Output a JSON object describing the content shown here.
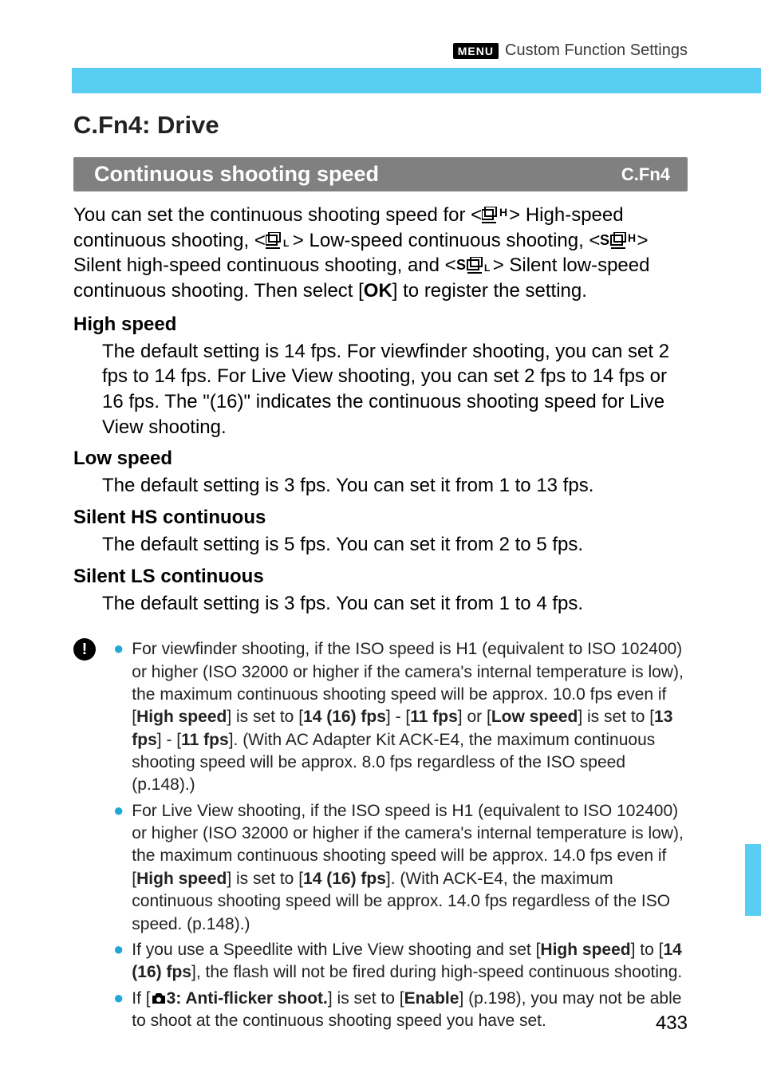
{
  "header": {
    "menu_badge": "MENU",
    "title": "Custom Function Settings"
  },
  "section": {
    "title": "C.Fn4: Drive"
  },
  "grayBar": {
    "title": "Continuous shooting speed",
    "right": "C.Fn4"
  },
  "intro": {
    "p1a": "You can set the continuous shooting speed for <",
    "p1b": "> High-speed continuous shooting, <",
    "p1c": "> Low-speed continuous shooting, <",
    "p1d": "> Silent high-speed continuous shooting, and <",
    "p1e": "> Silent low-speed continuous shooting. Then select [",
    "ok": "OK",
    "p1f": "] to register the setting."
  },
  "subs": {
    "hs_head": "High speed",
    "hs_body": "The default setting is 14 fps. For viewfinder shooting, you can set 2 fps to 14 fps. For Live View shooting, you can set 2 fps to 14 fps or 16 fps. The \"(16)\" indicates the continuous shooting speed for Live View shooting.",
    "ls_head": "Low speed",
    "ls_body": "The default setting is 3 fps. You can set it from 1 to 13 fps.",
    "shs_head": "Silent HS continuous",
    "shs_body": "The default setting is 5 fps. You can set it from 2 to 5 fps.",
    "sls_head": "Silent LS continuous",
    "sls_body": "The default setting is 3 fps. You can set it from 1 to 4 fps."
  },
  "notes": {
    "n1a": "For viewfinder shooting, if the ISO speed is H1 (equivalent to ISO 102400) or higher (ISO 32000 or higher if the camera's internal temperature is low), the maximum continuous shooting speed will be approx. 10.0 fps even if [",
    "n1b": "High speed",
    "n1c": "] is set to [",
    "n1d": "14 (16) fps",
    "n1e": "] - [",
    "n1f": "11 fps",
    "n1g": "] or [",
    "n1h": "Low speed",
    "n1i": "] is set to [",
    "n1j": "13 fps",
    "n1k": "] - [",
    "n1l": "11 fps",
    "n1m": "]. (With AC Adapter Kit ACK-E4, the maximum continuous shooting speed will be approx. 8.0 fps regardless of the ISO speed (p.148).)",
    "n2a": "For Live View shooting, if the ISO speed is H1 (equivalent to ISO 102400) or higher (ISO 32000 or higher if the camera's internal temperature is low), the maximum continuous shooting speed will be approx. 14.0 fps even if [",
    "n2b": "High speed",
    "n2c": "] is set to [",
    "n2d": "14 (16) fps",
    "n2e": "]. (With ACK-E4, the maximum continuous shooting speed will be approx. 14.0 fps regardless of the ISO speed. (p.148).)",
    "n3a": "If you use a Speedlite with Live View shooting and set [",
    "n3b": "High speed",
    "n3c": "] to [",
    "n3d": "14 (16) fps",
    "n3e": "], the flash will not be fired during high-speed continuous shooting.",
    "n4a": "If [",
    "n4b": "3: Anti-flicker shoot.",
    "n4c": "] is set to [",
    "n4d": "Enable",
    "n4e": "] (p.198), you may not be able to shoot at the continuous shooting speed you have set."
  },
  "page": "433"
}
